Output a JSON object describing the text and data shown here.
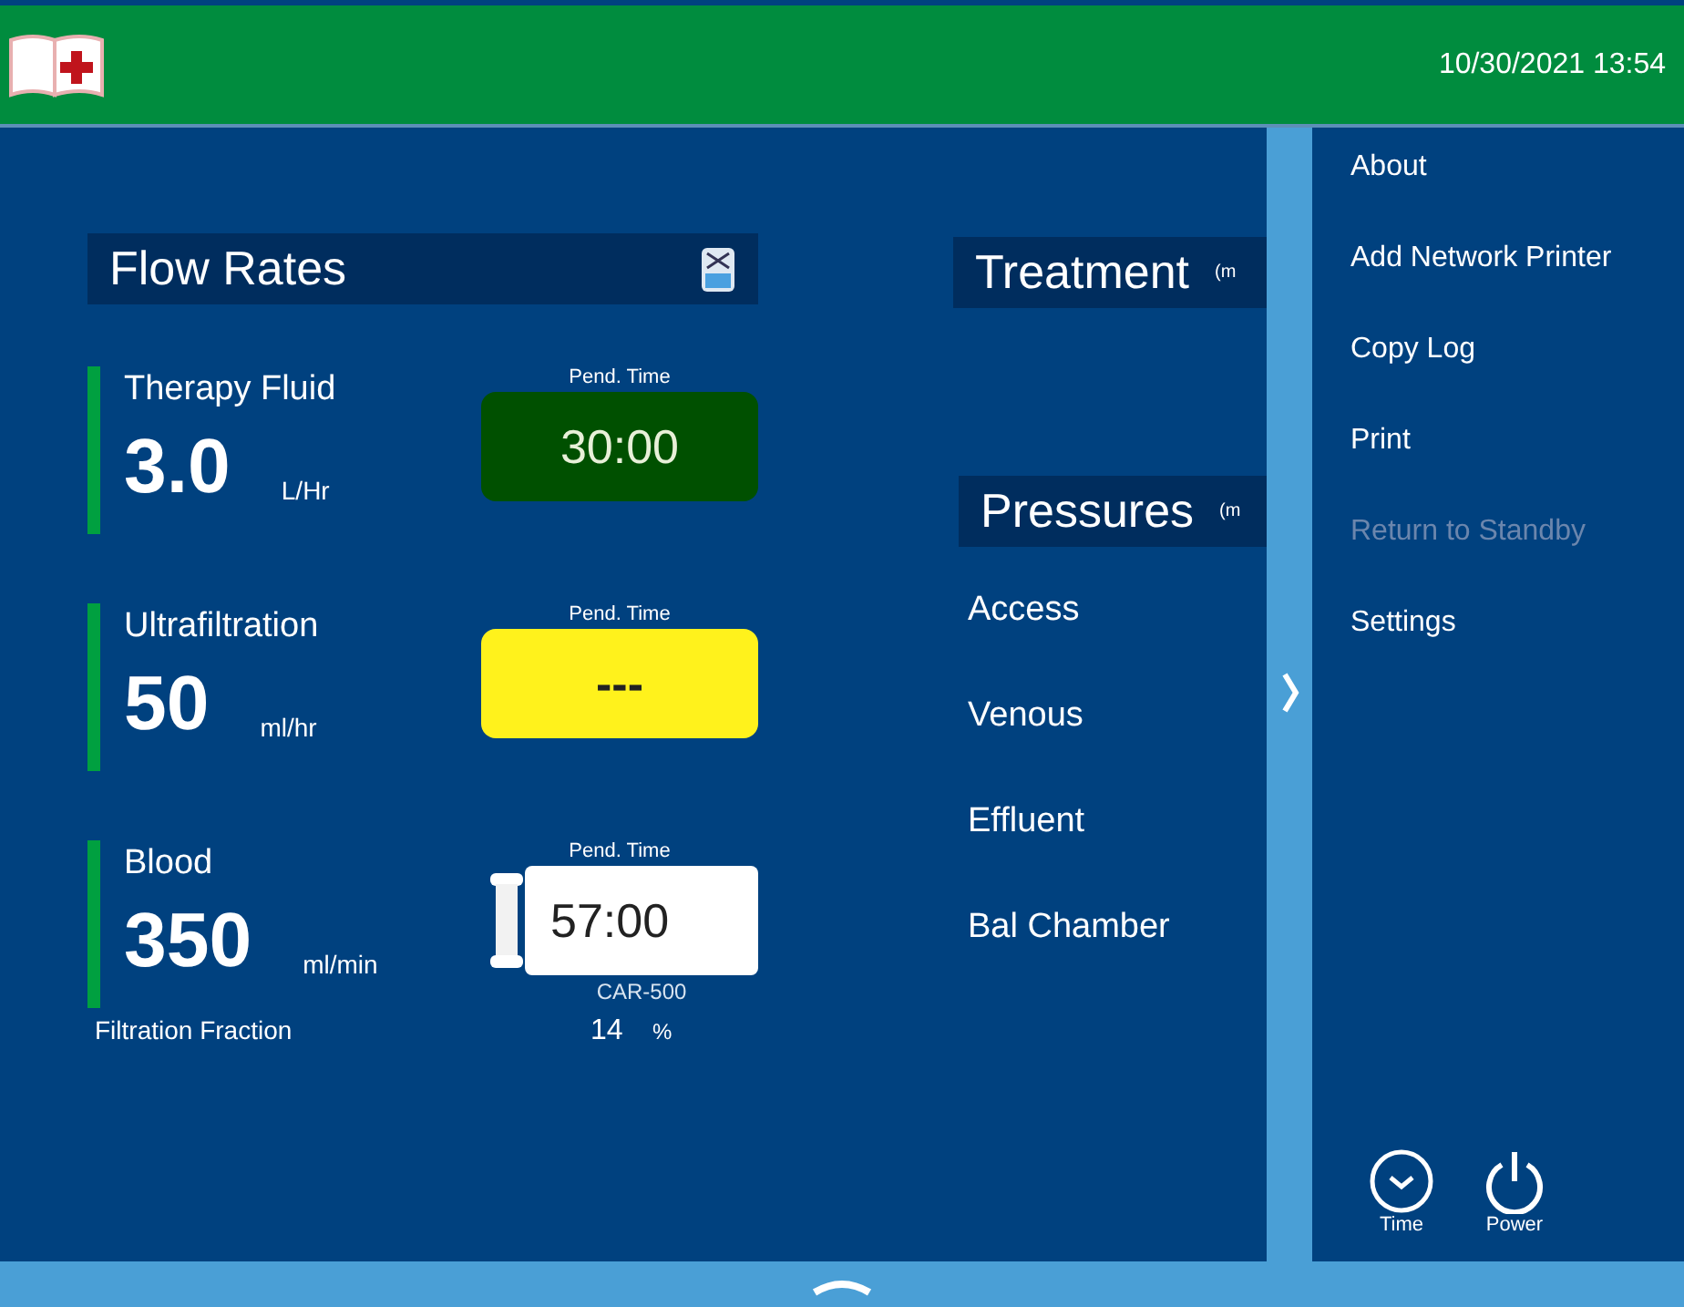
{
  "header": {
    "datetime": "10/30/2021 13:54"
  },
  "flow_rates": {
    "title": "Flow Rates",
    "rows": [
      {
        "label": "Therapy Fluid",
        "value": "3.0",
        "unit": "L/Hr",
        "pend_label": "Pend. Time",
        "pend_value": "30:00",
        "kind": "running",
        "filter": false
      },
      {
        "label": "Ultrafiltration",
        "value": "50",
        "unit": "ml/hr",
        "pend_label": "Pend. Time",
        "pend_value": "---",
        "kind": "warning",
        "filter": false
      },
      {
        "label": "Blood",
        "value": "350",
        "unit": "ml/min",
        "pend_label": "Pend. Time",
        "pend_value": "57:00",
        "kind": "entry",
        "filter": true,
        "filter_label": "CAR-500"
      }
    ],
    "fraction": {
      "label": "Filtration Fraction",
      "value": "14",
      "unit": "%"
    }
  },
  "treatment": {
    "title": "Treatment",
    "suffix": "(m"
  },
  "pressures": {
    "title": "Pressures",
    "suffix": "(m",
    "items": [
      "Access",
      "Venous",
      "Effluent",
      "Bal Chamber"
    ]
  },
  "menu": {
    "items": [
      {
        "label": "About",
        "disabled": false
      },
      {
        "label": "Add Network Printer",
        "disabled": false
      },
      {
        "label": "Copy Log",
        "disabled": false
      },
      {
        "label": "Print",
        "disabled": false
      },
      {
        "label": "Return to Standby",
        "disabled": true
      },
      {
        "label": "Settings",
        "disabled": false
      }
    ],
    "actions": [
      {
        "kind": "time",
        "label": "Time"
      },
      {
        "kind": "power",
        "label": "Power"
      }
    ]
  }
}
